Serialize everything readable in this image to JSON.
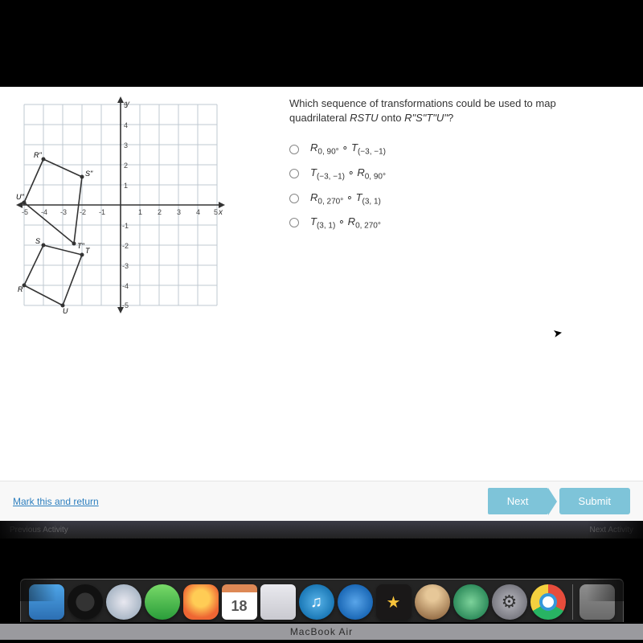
{
  "question": {
    "line1": "Which sequence of transformations could be used to map",
    "line2_prefix": "quadrilateral ",
    "line2_rstu": "RSTU",
    "line2_mid": " onto ",
    "line2_target": "R\"S\"T\"U\"",
    "line2_suffix": "?"
  },
  "options": [
    {
      "r_part": "R",
      "r_sub": "0, 90°",
      "comp": " ∘ ",
      "t_part": "T",
      "t_sub": "(−3, −1)"
    },
    {
      "t_part": "T",
      "t_sub": "(−3, −1)",
      "comp": " ∘ ",
      "r_part": "R",
      "r_sub": "0, 90°"
    },
    {
      "r_part": "R",
      "r_sub": "0, 270°",
      "comp": " ∘ ",
      "t_part": "T",
      "t_sub": "(3, 1)"
    },
    {
      "t_part": "T",
      "t_sub": "(3, 1)",
      "comp": " ∘ ",
      "r_part": "R",
      "r_sub": "0, 270°"
    }
  ],
  "buttons": {
    "mark": "Mark this and return",
    "next": "Next",
    "submit": "Submit"
  },
  "belowbar": {
    "left": "Previous Activity",
    "right": "Next Activity"
  },
  "dock": {
    "cal_day": "18"
  },
  "macbook": "MacBook Air",
  "chart_data": {
    "type": "scatter",
    "title": "",
    "xlabel": "x",
    "ylabel": "y",
    "xlim": [
      -5,
      5
    ],
    "ylim": [
      -5,
      5
    ],
    "series": [
      {
        "name": "RSTU",
        "points": {
          "R": [
            -5,
            -4
          ],
          "S": [
            -4,
            -2
          ],
          "T": [
            -2,
            -2.5
          ],
          "U": [
            -3,
            -5
          ]
        },
        "closed": true
      },
      {
        "name": "R\"S\"T\"U\"",
        "points": {
          "R\"": [
            -4,
            2.3
          ],
          "S\"": [
            -2,
            1.4
          ],
          "T\"": [
            -2.4,
            -2
          ],
          "U\"": [
            -5,
            0.1
          ]
        },
        "closed": true
      }
    ],
    "yaxis_labels": [
      "5",
      "4",
      "3",
      "2",
      "1",
      "-1",
      "-2",
      "-3",
      "-4",
      "-5"
    ],
    "xaxis_labels": [
      "-5",
      "-4",
      "-3",
      "-2",
      "-1",
      "1",
      "2",
      "3",
      "4",
      "5"
    ]
  }
}
